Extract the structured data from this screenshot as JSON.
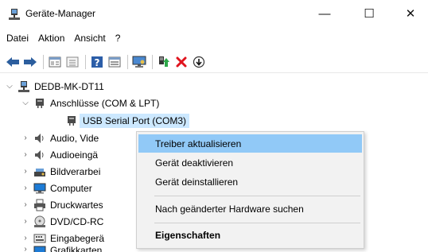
{
  "window": {
    "title": "Geräte-Manager",
    "icon": "device-manager-icon",
    "controls": {
      "minimize": "—",
      "maximize": "☐",
      "close": "✕"
    }
  },
  "menu": {
    "items": [
      "Datei",
      "Aktion",
      "Ansicht",
      "?"
    ]
  },
  "toolbar": {
    "buttons": [
      "back-arrow-icon",
      "forward-arrow-icon",
      "properties-icon",
      "show-hide-tree-icon",
      "help-icon",
      "view-icon",
      "monitor-icon",
      "update-driver-icon",
      "uninstall-icon",
      "enable-device-icon"
    ]
  },
  "tree": {
    "root": "DEDB-MK-DT11",
    "ports_category": "Anschlüsse (COM & LPT)",
    "selected_device": "USB Serial Port (COM3)",
    "categories": [
      "Audio, Vide",
      "Audioeingä",
      "Bildverarbei",
      "Computer",
      "Druckwartes",
      "DVD/CD-RC",
      "Eingabegerä",
      "Grafikkarten"
    ]
  },
  "context_menu": {
    "update_driver": "Treiber aktualisieren",
    "disable": "Gerät deaktivieren",
    "uninstall": "Gerät deinstallieren",
    "scan": "Nach geänderter Hardware suchen",
    "properties": "Eigenschaften"
  },
  "colors": {
    "selection": "#cce8ff",
    "menu_highlight": "#91c9f7",
    "menu_bg": "#f2f2f2"
  }
}
